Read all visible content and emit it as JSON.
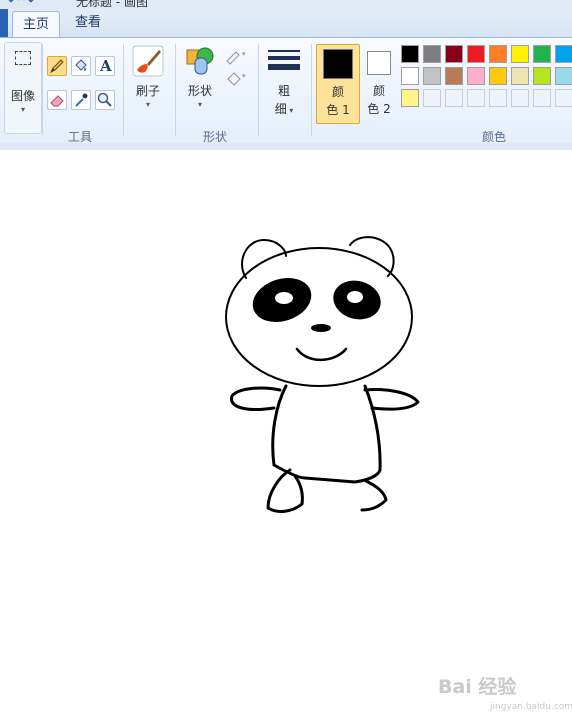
{
  "window": {
    "title": "无标题 - 画图"
  },
  "tabs": {
    "home": "主页",
    "view": "查看"
  },
  "ribbon": {
    "image_label": "图像",
    "tools_label": "工具",
    "text_tool": "A",
    "brushes_label": "刷子",
    "shapes_label": "形状",
    "shapes_group_label": "形状",
    "size_label_1": "粗",
    "size_label_2": "细",
    "color1_label_1": "颜",
    "color1_label_2": "色 1",
    "color2_label_1": "颜",
    "color2_label_2": "色 2",
    "colors_group_label": "颜色"
  },
  "palette": {
    "row1": [
      "#000000",
      "#7f7f7f",
      "#880015",
      "#ed1c24",
      "#ff7f27",
      "#fff200",
      "#22b14c",
      "#00a2e8"
    ],
    "row2": [
      "#ffffff",
      "#c3c3c3",
      "#b97a57",
      "#ffaec9",
      "#ffc90e",
      "#efe4b0",
      "#b5e61d",
      "#99d9ea"
    ],
    "row3": [
      "#fff38a",
      "",
      "",
      "",
      "",
      "",
      "",
      ""
    ]
  },
  "colors": {
    "color1": "#000000",
    "color2": "#ffffff"
  },
  "watermark": {
    "brand": "Bai 经验",
    "sub": "jingyan.baidu.com"
  }
}
